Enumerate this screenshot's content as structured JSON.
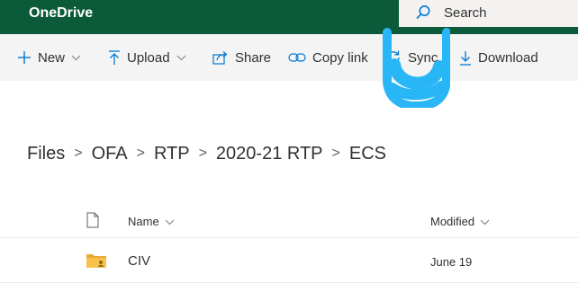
{
  "app": {
    "title": "OneDrive"
  },
  "search": {
    "label": "Search",
    "icon": "search-icon"
  },
  "toolbar": {
    "new_label": "New",
    "upload_label": "Upload",
    "share_label": "Share",
    "copy_link_label": "Copy link",
    "sync_label": "Sync",
    "download_label": "Download"
  },
  "breadcrumb": [
    "Files",
    "OFA",
    "RTP",
    "2020-21 RTP",
    "ECS"
  ],
  "breadcrumb_separator": ">",
  "list": {
    "columns": {
      "name": "Name",
      "modified": "Modified"
    },
    "rows": [
      {
        "name": "CIV",
        "modified": "June 19",
        "type": "folder"
      }
    ]
  },
  "colors": {
    "suite_bar": "#0b5a3a",
    "accent": "#0078d4",
    "highlight_scribble": "#29b6f6",
    "folder": "#f8c24a"
  }
}
